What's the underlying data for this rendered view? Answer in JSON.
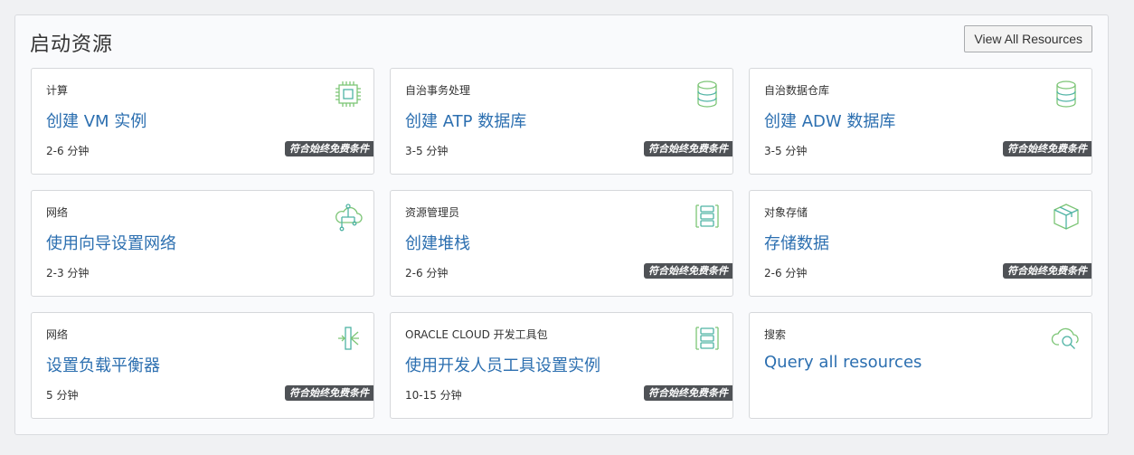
{
  "panel": {
    "title": "启动资源",
    "view_all_label": "View All Resources"
  },
  "badge_text": "符合始终免费条件",
  "colors": {
    "link": "#2c6fb0",
    "badge_bg": "#4f5256",
    "icon_green": "#7cc576",
    "icon_teal": "#4fb3a4"
  },
  "cards": [
    {
      "category": "计算",
      "title": "创建 VM 实例",
      "time": "2-6 分钟",
      "icon": "chip-icon",
      "free_tier": true
    },
    {
      "category": "自治事务处理",
      "title": "创建 ATP 数据库",
      "time": "3-5 分钟",
      "icon": "database-icon",
      "free_tier": true
    },
    {
      "category": "自治数据仓库",
      "title": "创建 ADW 数据库",
      "time": "3-5 分钟",
      "icon": "database-icon",
      "free_tier": true
    },
    {
      "category": "网络",
      "title": "使用向导设置网络",
      "time": "2-3 分钟",
      "icon": "network-cloud-icon",
      "free_tier": false
    },
    {
      "category": "资源管理员",
      "title": "创建堆栈",
      "time": "2-6 分钟",
      "icon": "stack-icon",
      "free_tier": true
    },
    {
      "category": "对象存储",
      "title": "存储数据",
      "time": "2-6 分钟",
      "icon": "box-icon",
      "free_tier": true
    },
    {
      "category": "网络",
      "title": "设置负载平衡器",
      "time": "5 分钟",
      "icon": "load-balancer-icon",
      "free_tier": true
    },
    {
      "category": "ORACLE CLOUD 开发工具包",
      "title": "使用开发人员工具设置实例",
      "time": "10-15 分钟",
      "icon": "stack-icon",
      "free_tier": true
    },
    {
      "category": "搜索",
      "title": "Query all resources",
      "time": "",
      "icon": "cloud-search-icon",
      "free_tier": false
    }
  ]
}
